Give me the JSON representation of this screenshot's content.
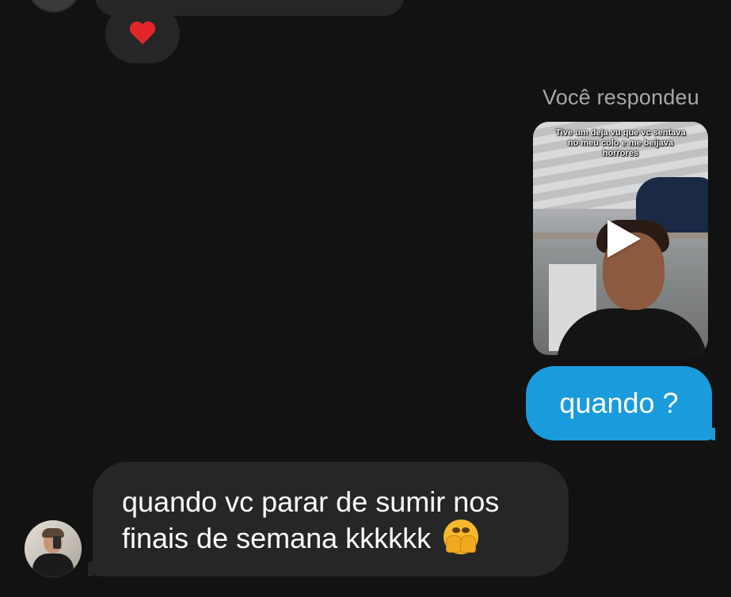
{
  "thread": {
    "reaction": {
      "icon": "red-heart-icon"
    },
    "reply": {
      "label": "Você respondeu",
      "video": {
        "caption": "Tive um deja vu que vc sentava no meu colo e me beijava horrores",
        "icon": "play-icon"
      },
      "message": "quando ?"
    },
    "received": {
      "message": "quando vc parar de sumir nos finais de semana kkkkkk",
      "emoji": "face-with-open-eyes-and-hand-over-mouth-icon"
    }
  },
  "colors": {
    "background": "#121212",
    "sent_bubble": "#1a9bdb",
    "received_bubble": "#262626",
    "muted_text": "#a8a8a8"
  }
}
